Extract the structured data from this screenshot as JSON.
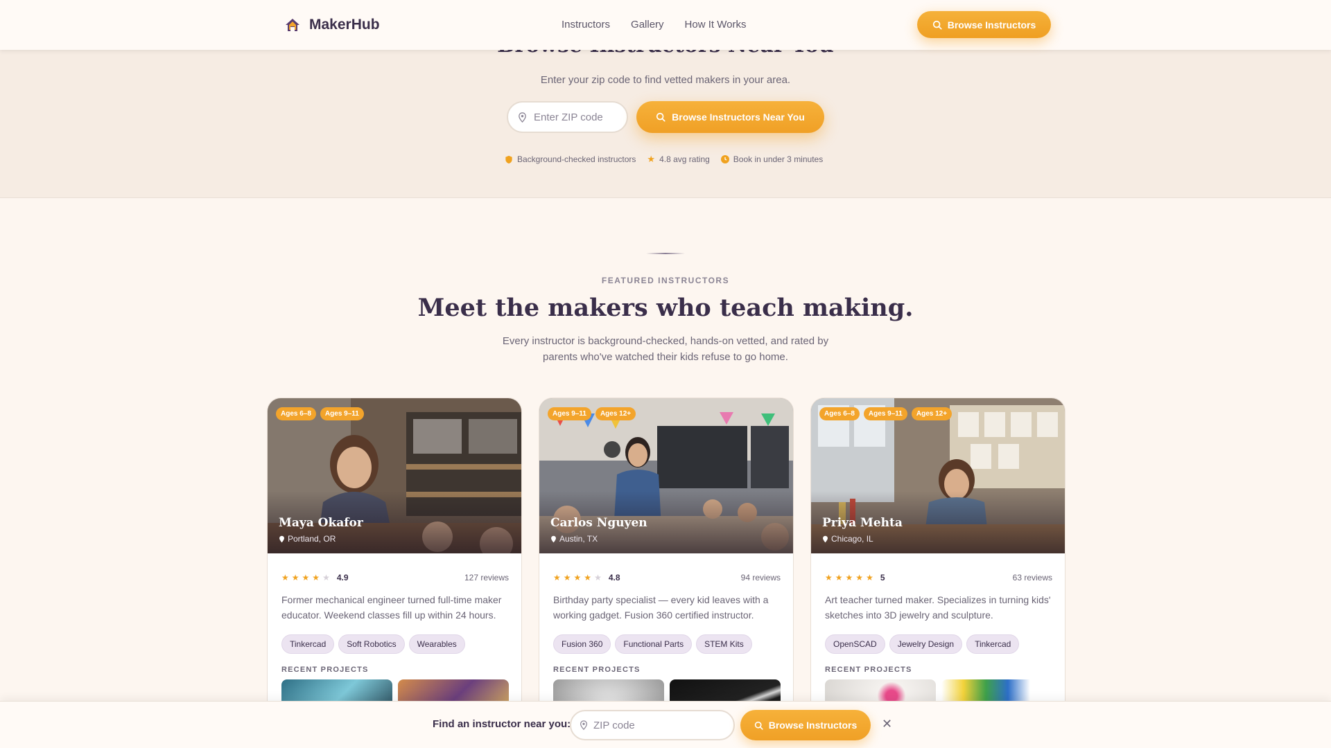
{
  "brand": {
    "name": "MakerHub",
    "icon": "house-logo-icon"
  },
  "nav": {
    "links": [
      "Instructors",
      "Gallery",
      "How It Works"
    ],
    "cta_label": "Browse Instructors"
  },
  "hero": {
    "title": "Browse Instructors Near You",
    "subtitle": "Enter your zip code to find vetted makers in your area.",
    "zip_placeholder": "Enter ZIP code",
    "cta_label": "Browse Instructors Near You",
    "trust": [
      {
        "icon": "shield-icon",
        "label": "Background-checked instructors"
      },
      {
        "icon": "star-icon",
        "label": "4.8 avg rating"
      },
      {
        "icon": "clock-icon",
        "label": "Book in under 3 minutes"
      }
    ]
  },
  "featured": {
    "eyebrow": "FEATURED INSTRUCTORS",
    "title": "Meet the makers who teach making.",
    "subtitle": "Every instructor is background-checked, hands-on vetted, and rated by parents who've watched their kids refuse to go home.",
    "recent_label": "RECENT PROJECTS",
    "cards": [
      {
        "name": "Maya Okafor",
        "location": "Portland, OR",
        "ages": [
          "Ages 6–8",
          "Ages 9–11"
        ],
        "stars": 4,
        "rating": "4.9",
        "reviews": "127 reviews",
        "bio": "Former mechanical engineer turned full-time maker educator. Weekend classes fill up within 24 hours.",
        "tags": [
          "Tinkercad",
          "Soft Robotics",
          "Wearables"
        ]
      },
      {
        "name": "Carlos Nguyen",
        "location": "Austin, TX",
        "ages": [
          "Ages 9–11",
          "Ages 12+"
        ],
        "stars": 4,
        "rating": "4.8",
        "reviews": "94 reviews",
        "bio": "Birthday party specialist — every kid leaves with a working gadget. Fusion 360 certified instructor.",
        "tags": [
          "Fusion 360",
          "Functional Parts",
          "STEM Kits"
        ]
      },
      {
        "name": "Priya Mehta",
        "location": "Chicago, IL",
        "ages": [
          "Ages 6–8",
          "Ages 9–11",
          "Ages 12+"
        ],
        "stars": 5,
        "rating": "5",
        "reviews": "63 reviews",
        "bio": "Art teacher turned maker. Specializes in turning kids' sketches into 3D jewelry and sculpture.",
        "tags": [
          "OpenSCAD",
          "Jewelry Design",
          "Tinkercad"
        ]
      }
    ]
  },
  "dock": {
    "label": "Find an instructor near you:",
    "zip_placeholder": "ZIP code",
    "cta_label": "Browse Instructors",
    "close_icon": "close-icon"
  },
  "colors": {
    "accent": "#f3a42b",
    "text": "#3a2e4a",
    "background": "#fdf6f0"
  }
}
